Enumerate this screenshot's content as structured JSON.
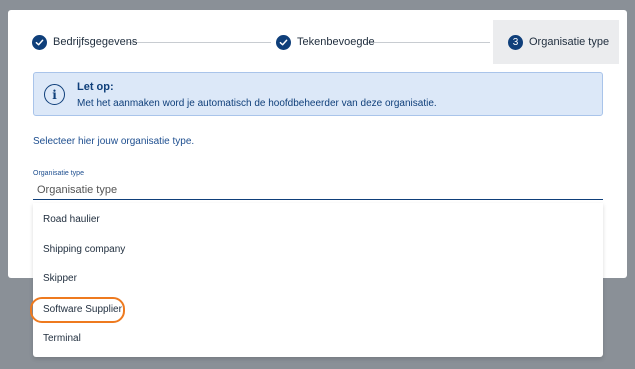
{
  "stepper": {
    "steps": [
      {
        "number": "",
        "label": "Bedrijfsgegevens",
        "state": "done"
      },
      {
        "number": "",
        "label": "Tekenbevoegde",
        "state": "done"
      },
      {
        "number": "3",
        "label": "Organisatie type",
        "state": "active"
      }
    ]
  },
  "alert": {
    "title": "Let op:",
    "message": "Met het aanmaken word je automatisch de hoofdbeheerder van deze organisatie.",
    "icon": "info-icon"
  },
  "instruction": "Selecteer hier jouw organisatie type.",
  "field": {
    "label": "Organisatie type",
    "placeholder": "Organisatie type",
    "value": ""
  },
  "dropdown": {
    "options": [
      "Road haulier",
      "Shipping company",
      "Skipper",
      "Software Supplier",
      "Terminal"
    ],
    "highlighted_index": 3
  },
  "colors": {
    "primary": "#0f3f7a",
    "alert_bg": "#dce8f8",
    "highlight": "#ee7a1f",
    "backdrop": "#8a9097"
  }
}
